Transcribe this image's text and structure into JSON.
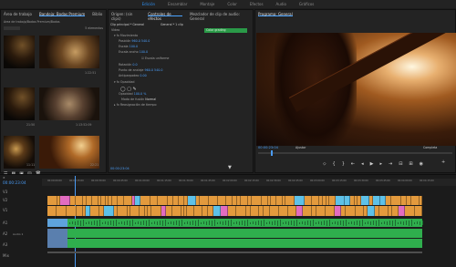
{
  "topbar": {
    "items": [
      "Edición",
      "Ensamblar",
      "Montaje",
      "Color",
      "Efectos",
      "Audio",
      "Gráficos"
    ],
    "active_index": 0
  },
  "project_panel": {
    "tabs": [
      "Área de trabajo",
      "Bandeja: Bodas Premium",
      "Biblio"
    ],
    "path": "Area de trabajo/Bodas Premium/Bodas",
    "count": "5 elementos",
    "clips": [
      {
        "name": "",
        "dur": ""
      },
      {
        "name": "",
        "dur": "1:22:51"
      },
      {
        "name": "",
        "dur": "21:50"
      },
      {
        "name": "",
        "dur": "1:13:52:09"
      },
      {
        "name": "",
        "dur": "11:11"
      },
      {
        "name": "",
        "dur": "22:21"
      }
    ]
  },
  "effects_panel": {
    "tabs": [
      "Origen: (sin clips)",
      "Controles de efectos",
      "Mezclador de clip de audio: General"
    ],
    "clip_label": "Clip principal * General",
    "sequence_label": "General * 1 clip",
    "timecode": "00:00:23:04",
    "sections": [
      {
        "label": "Vídeo"
      },
      {
        "label": "Movimiento"
      },
      {
        "label": "Posición",
        "value": "960.0  540.0"
      },
      {
        "label": "Escala",
        "value": "100.0"
      },
      {
        "label": "Escala ancho",
        "value": "100.0"
      },
      {
        "label": "Escala uniforme"
      },
      {
        "label": "Rotación",
        "value": "0.0"
      },
      {
        "label": "Punto de anclaje",
        "value": "960.0  540.0"
      },
      {
        "label": "Antiparpadeo",
        "value": "0.00"
      },
      {
        "label": "Opacidad"
      },
      {
        "label": "Opacidad",
        "value": "100.0 %"
      },
      {
        "label": "Modo de fusión",
        "value": "Normal"
      },
      {
        "label": "Reasignación de tiempo"
      }
    ],
    "clip_bar_label": "Color grading"
  },
  "program_monitor": {
    "tab": "Programa: General",
    "timecode": "00:00:23:04",
    "fit": "Ajustar",
    "full": "Completa",
    "duration": "00:04:32:18"
  },
  "timeline": {
    "timecode": "00:00:23:04",
    "ruler_labels": [
      "00:00:00:00",
      "00:00:15:00",
      "00:00:30:00",
      "00:00:45:00",
      "00:01:00:00",
      "00:01:15:00",
      "00:01:30:00",
      "00:01:45:00",
      "00:02:00:00",
      "00:02:15:00",
      "00:02:30:00",
      "00:02:45:00",
      "00:03:00:00",
      "00:03:15:00",
      "00:03:30:00",
      "00:03:45:00",
      "00:04:00:00",
      "00:04:15:00"
    ],
    "tracks": [
      "V3",
      "V2",
      "V1",
      "A1",
      "A2",
      "A3",
      "Mix"
    ],
    "audio_label": "Audio 1",
    "video_label": "Vídeo 1"
  }
}
